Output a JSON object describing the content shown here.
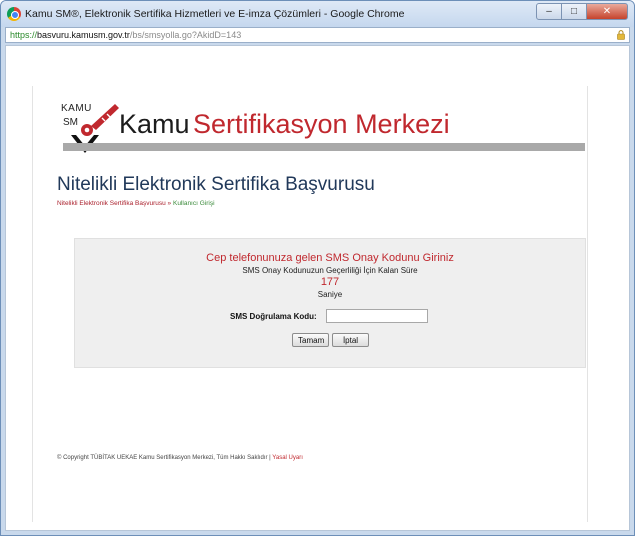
{
  "window": {
    "title": "Kamu SM®, Elektronik Sertifika Hizmetleri ve E-imza Çözümleri - Google Chrome",
    "buttons": {
      "minimize": "–",
      "maximize": "□",
      "close": "✕"
    }
  },
  "address": {
    "scheme": "https://",
    "host": "basvuru.kamusm.gov.tr",
    "path": "/bs/smsyolla.go?AkidD=143"
  },
  "logo": {
    "kamu_small": "KAMU",
    "sm_small": "SM",
    "kamu": "Kamu",
    "rest": "Sertifikasyon Merkezi"
  },
  "page": {
    "title": "Nitelikli Elektronik Sertifika Başvurusu",
    "breadcrumb": {
      "parent": "Nitelikli Elektronik Sertifika Başvurusu",
      "separator": "»",
      "current": "Kullanıcı Girişi"
    }
  },
  "sms": {
    "heading": "Cep telefonunuza gelen SMS Onay Kodunu Giriniz",
    "validity_label": "SMS Onay Kodunuzun Geçerliliği İçin Kalan Süre",
    "remaining": "177",
    "unit": "Saniye",
    "code_label": "SMS Doğrulama Kodu:",
    "code_value": "",
    "ok_label": "Tamam",
    "cancel_label": "İptal"
  },
  "footer": {
    "copyright": "© Copyright TÜBİTAK UEKAE Kamu Sertifikasyon Merkezi, Tüm Hakkı Saklıdır",
    "separator": "|",
    "legal": "Yasal Uyarı"
  },
  "colors": {
    "brand_red": "#c0282e",
    "title_navy": "#21395a",
    "crumb_green": "#3a8a3a"
  }
}
